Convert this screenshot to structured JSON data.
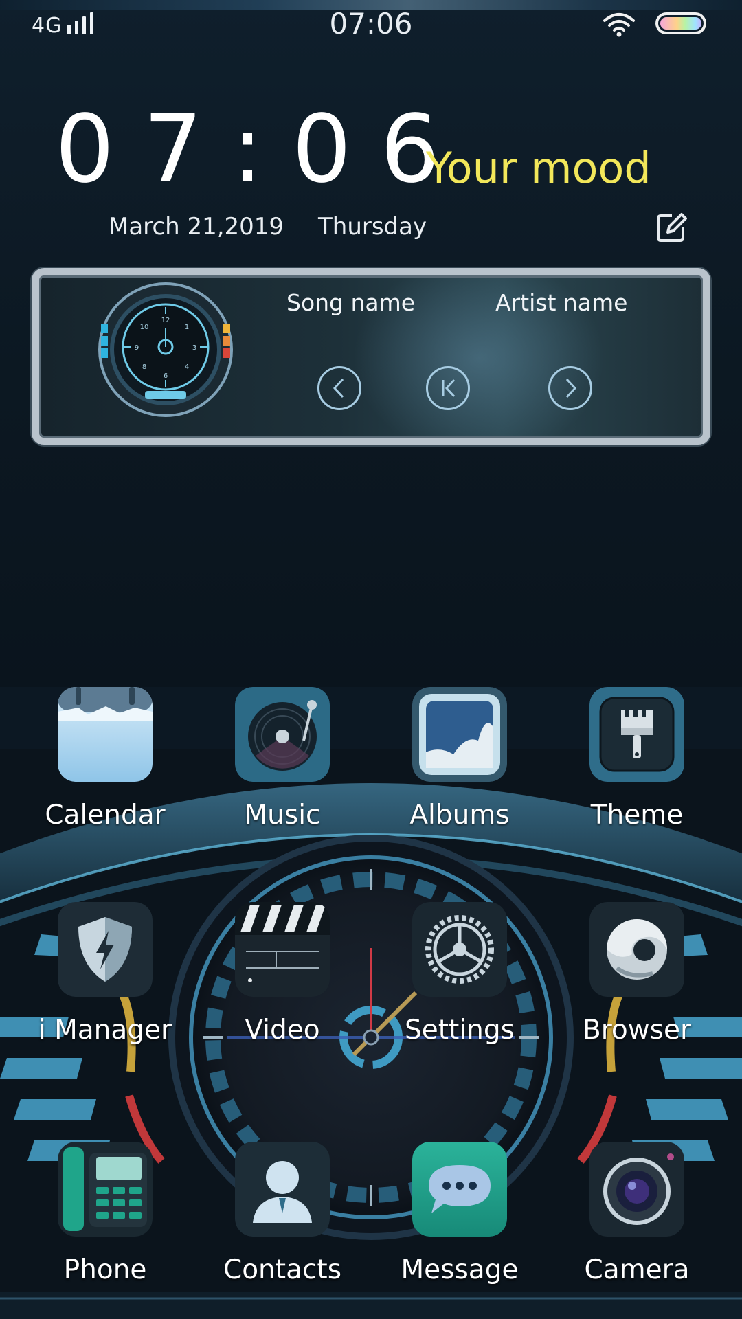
{
  "status_bar": {
    "network": "4G",
    "time": "07:06"
  },
  "clock_widget": {
    "time": "07:06",
    "mood": "Your mood",
    "date": "March 21,2019",
    "weekday": "Thursday"
  },
  "music_widget": {
    "song_name": "Song name",
    "artist_name": "Artist name"
  },
  "apps": [
    {
      "label": "Calendar",
      "icon": "calendar-icon"
    },
    {
      "label": "Music",
      "icon": "music-icon"
    },
    {
      "label": "Albums",
      "icon": "albums-icon"
    },
    {
      "label": "Theme",
      "icon": "theme-icon"
    },
    {
      "label": "i Manager",
      "icon": "shield-icon"
    },
    {
      "label": "Video",
      "icon": "clapperboard-icon"
    },
    {
      "label": "Settings",
      "icon": "gear-icon"
    },
    {
      "label": "Browser",
      "icon": "browser-icon"
    },
    {
      "label": "Phone",
      "icon": "phone-icon"
    },
    {
      "label": "Contacts",
      "icon": "contacts-icon"
    },
    {
      "label": "Message",
      "icon": "message-icon"
    },
    {
      "label": "Camera",
      "icon": "camera-icon"
    }
  ],
  "colors": {
    "background": "#0c1823",
    "mood_accent": "#f2e75a",
    "dashboard_cyan": "#4a9cc0"
  }
}
